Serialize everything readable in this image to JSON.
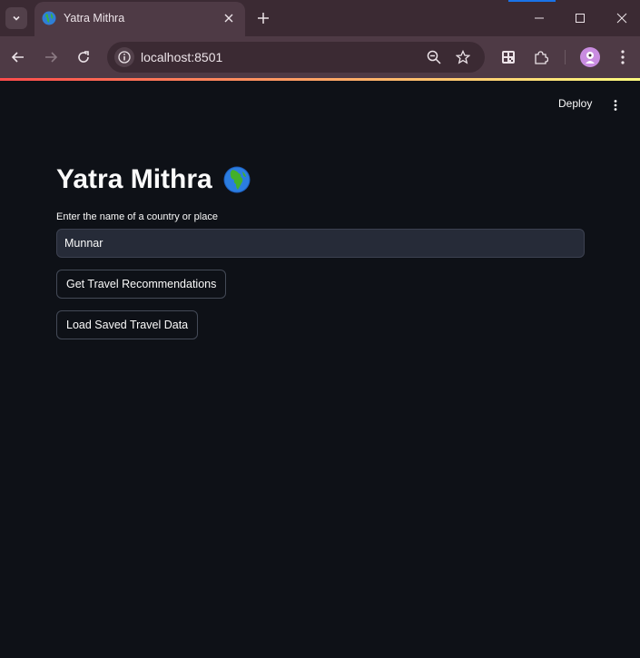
{
  "browser": {
    "tab_title": "Yatra Mithra",
    "url": "localhost:8501"
  },
  "app": {
    "deploy_label": "Deploy",
    "title": "Yatra Mithra",
    "title_icon": "globe-africa-emoji",
    "input": {
      "label": "Enter the name of a country or place",
      "value": "Munnar"
    },
    "buttons": {
      "recommend": "Get Travel Recommendations",
      "load": "Load Saved Travel Data"
    }
  },
  "colors": {
    "background": "#0e1117",
    "chrome": "#4e3a45",
    "accent_gradient_start": "#ff4b4b",
    "accent_gradient_end": "#fffd80"
  }
}
